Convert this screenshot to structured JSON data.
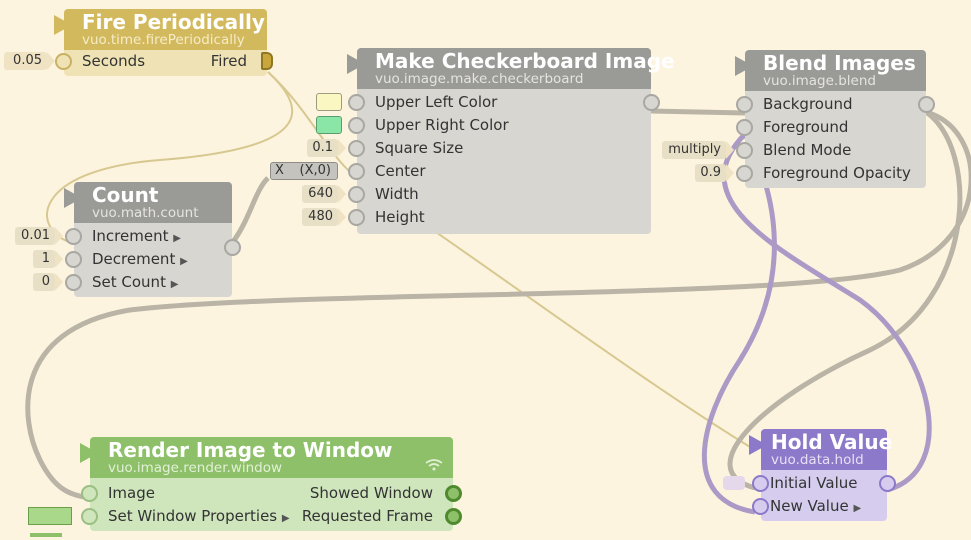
{
  "nodes": {
    "fire": {
      "title": "Fire Periodically",
      "cls": "vuo.time.firePeriodically",
      "inputs": [
        {
          "label": "Seconds",
          "const": "0.05"
        }
      ],
      "outputs": [
        {
          "label": "Fired"
        }
      ]
    },
    "count": {
      "title": "Count",
      "cls": "vuo.math.count",
      "inputs": [
        {
          "label": "Increment",
          "const": "0.01"
        },
        {
          "label": "Decrement",
          "const": "1"
        },
        {
          "label": "Set Count",
          "const": "0"
        }
      ]
    },
    "checker": {
      "title": "Make Checkerboard Image",
      "cls": "vuo.image.make.checkerboard",
      "inputs": [
        {
          "label": "Upper Left Color"
        },
        {
          "label": "Upper Right Color"
        },
        {
          "label": "Square Size",
          "const": "0.1"
        },
        {
          "label": "Center",
          "const": "(X,0)",
          "prefix": "X"
        },
        {
          "label": "Width",
          "const": "640"
        },
        {
          "label": "Height",
          "const": "480"
        }
      ]
    },
    "blend": {
      "title": "Blend Images",
      "cls": "vuo.image.blend",
      "inputs": [
        {
          "label": "Background"
        },
        {
          "label": "Foreground"
        },
        {
          "label": "Blend Mode",
          "const": "multiply"
        },
        {
          "label": "Foreground Opacity",
          "const": "0.9"
        }
      ]
    },
    "render": {
      "title": "Render Image to Window",
      "cls": "vuo.image.render.window",
      "inputs": [
        {
          "label": "Image"
        },
        {
          "label": "Set Window Properties"
        }
      ],
      "outputs": [
        {
          "label": "Showed Window"
        },
        {
          "label": "Requested Frame"
        }
      ]
    },
    "hold": {
      "title": "Hold Value",
      "cls": "vuo.data.hold",
      "inputs": [
        {
          "label": "Initial Value"
        },
        {
          "label": "New Value"
        }
      ]
    }
  },
  "colors": {
    "canvas": "#fdf4e0",
    "yellow_header": "#d3b95d",
    "yellow_body": "#efe3b6",
    "gray_header": "#9a9a96",
    "gray_body": "#d7d6d1",
    "green_header": "#8ec06a",
    "green_body": "#cfe6bd",
    "purple_header": "#8c79c9",
    "purple_body": "#d6cdee",
    "cable_gray": "#bab4a6",
    "cable_yellow": "#d7c890",
    "cable_purple": "#ab9ac6",
    "color_port_ul": "#fbf7c2",
    "color_port_ur": "#8ae6a6"
  },
  "icons": {
    "render_window": "wifi-icon",
    "node_trigger": "play-triangle-icon"
  }
}
